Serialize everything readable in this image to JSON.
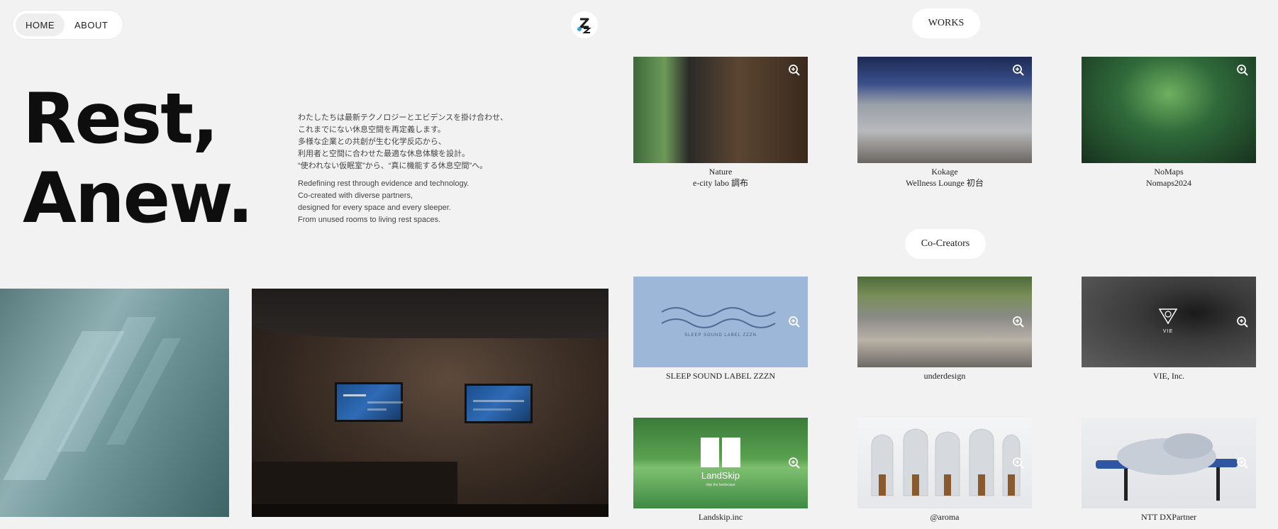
{
  "nav": {
    "items": [
      {
        "label": "HOME",
        "active": true
      },
      {
        "label": "ABOUT",
        "active": false
      }
    ]
  },
  "logo": {
    "icon": "zzzn-logo-icon",
    "color": "#1a1a1a",
    "accent": "#3aa0d8"
  },
  "hero": {
    "title_line1": "Rest,",
    "title_line2": "Anew.",
    "jp_lines": [
      "わたしたちは最新テクノロジーとエビデンスを掛け合わせ、",
      "これまでにない休息空間を再定義します。",
      "多様な企業との共創が生む化学反応から、",
      "利用者と空間に合わせた最適な休息体験を設計。",
      "“使われない仮眠室”から、“真に機能する休息空間”へ。"
    ],
    "en_lines": [
      "Redefining rest through evidence and technology.",
      "Co-created with diverse partners,",
      "designed for every space and every sleeper.",
      "From unused rooms to living rest spaces."
    ]
  },
  "sections": {
    "works_label": "WORKS",
    "cocreators_label": "Co-Creators"
  },
  "works": [
    {
      "line1": "Nature",
      "line2": "e-city labo 調布"
    },
    {
      "line1": "Kokage",
      "line2": "Wellness Lounge 初台"
    },
    {
      "line1": "NoMaps",
      "line2": "Nomaps2024"
    }
  ],
  "cocreators": [
    {
      "name": "SLEEP SOUND LABEL ZZZN",
      "logo_text": "SLEEP SOUND LABEL ZZZN"
    },
    {
      "name": "underdesign"
    },
    {
      "name": "VIE, Inc.",
      "logo_text": "VIE"
    },
    {
      "name": "Landskip.inc",
      "logo_text": "LandSkip",
      "logo_sub": "skip the landscape"
    },
    {
      "name": "@aroma"
    },
    {
      "name": "NTT DXPartner"
    }
  ],
  "icons": {
    "zoom": "zoom-in-icon"
  },
  "colors": {
    "background": "#f2f2f2",
    "pill": "#ffffff",
    "text": "#222222",
    "zzzn_blue": "#9db7d9"
  }
}
